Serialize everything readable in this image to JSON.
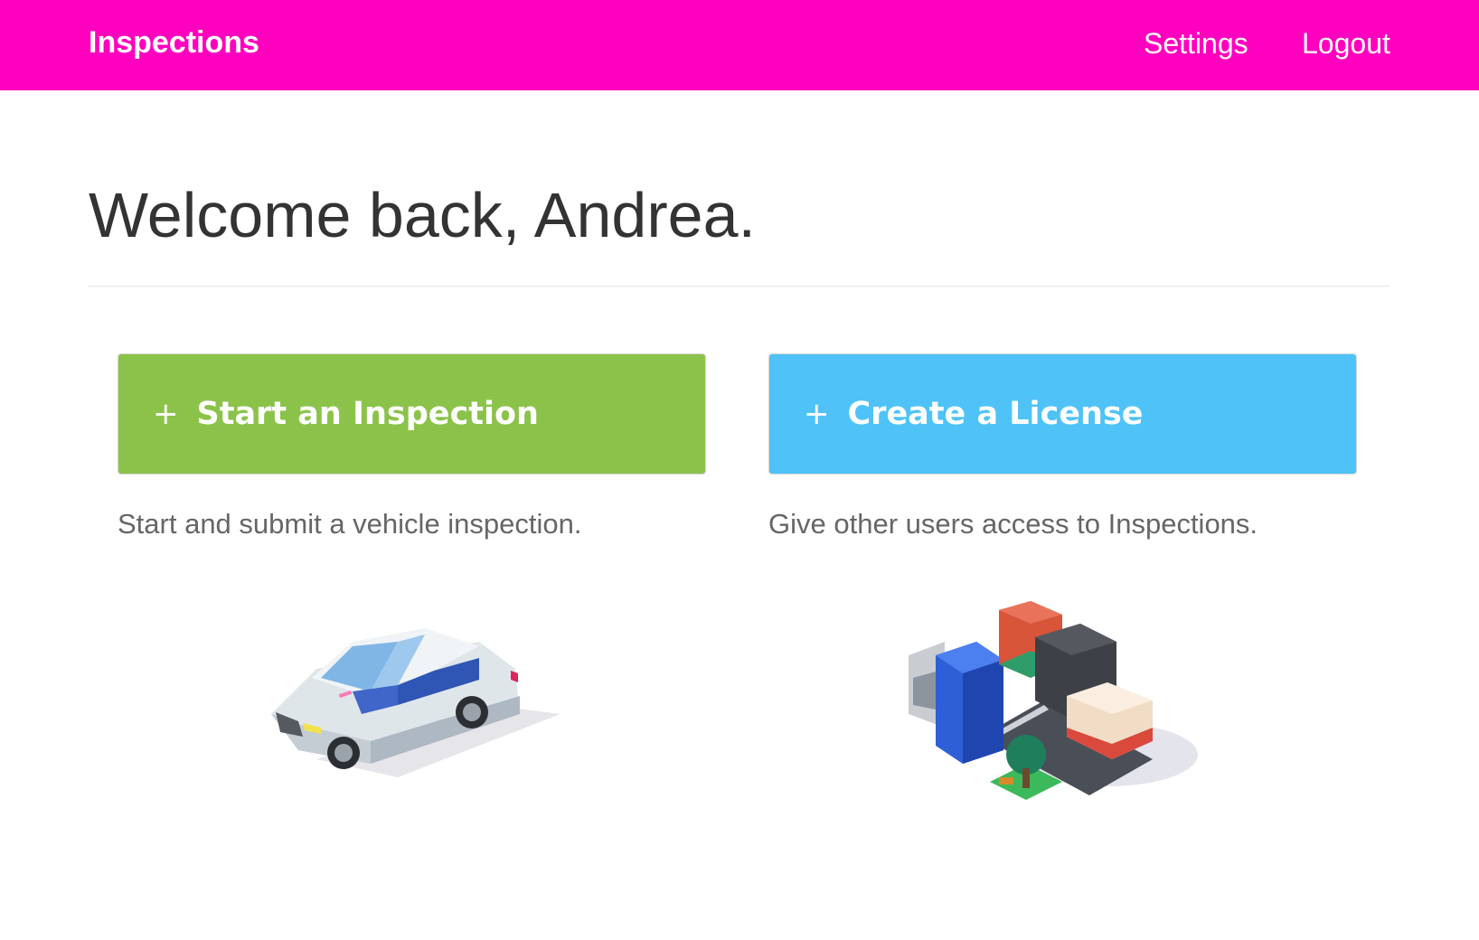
{
  "navbar": {
    "brand": "Inspections",
    "links": {
      "settings": "Settings",
      "logout": "Logout"
    },
    "background": "#ff00bf"
  },
  "main": {
    "welcome": "Welcome back, Andrea.",
    "actions": [
      {
        "icon": "plus-icon",
        "plus": "+",
        "label": "Start an Inspection",
        "description": "Start and submit a vehicle inspection.",
        "color": "#8bc34a",
        "illustration": "car-illustration"
      },
      {
        "icon": "plus-icon",
        "plus": "+",
        "label": "Create a License",
        "description": "Give other users access to Inspections.",
        "color": "#4fc3f7",
        "illustration": "city-illustration"
      }
    ]
  }
}
